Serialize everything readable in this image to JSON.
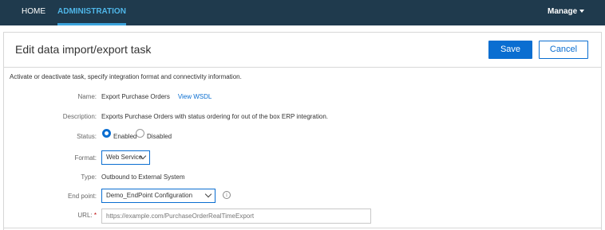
{
  "nav": {
    "home": "HOME",
    "administration": "ADMINISTRATION",
    "manage": "Manage"
  },
  "page": {
    "title": "Edit data import/export task",
    "description": "Activate or deactivate task, specify integration format and connectivity information."
  },
  "toolbar": {
    "save_label": "Save",
    "cancel_label": "Cancel"
  },
  "form": {
    "name": {
      "label": "Name:",
      "value": "Export Purchase Orders",
      "link": "View WSDL"
    },
    "description": {
      "label": "Description:",
      "value": "Exports Purchase Orders with status ordering for out of the box ERP integration."
    },
    "status": {
      "label": "Status:",
      "options": [
        "Enabled",
        "Disabled"
      ],
      "selected": "Enabled"
    },
    "format": {
      "label": "Format:",
      "value": "Web Service"
    },
    "type": {
      "label": "Type:",
      "value": "Outbound to External System"
    },
    "endpoint": {
      "label": "End point:",
      "value": "Demo_EndPoint Configuration",
      "info": "i"
    },
    "url": {
      "label": "URL:",
      "required_mark": "*",
      "placeholder": "https://example.com/PurchaseOrderRealTimeExport"
    }
  },
  "colors": {
    "topbar": "#1f3a4d",
    "accent": "#0a6ed1",
    "active_tab": "#4fb6e8"
  }
}
